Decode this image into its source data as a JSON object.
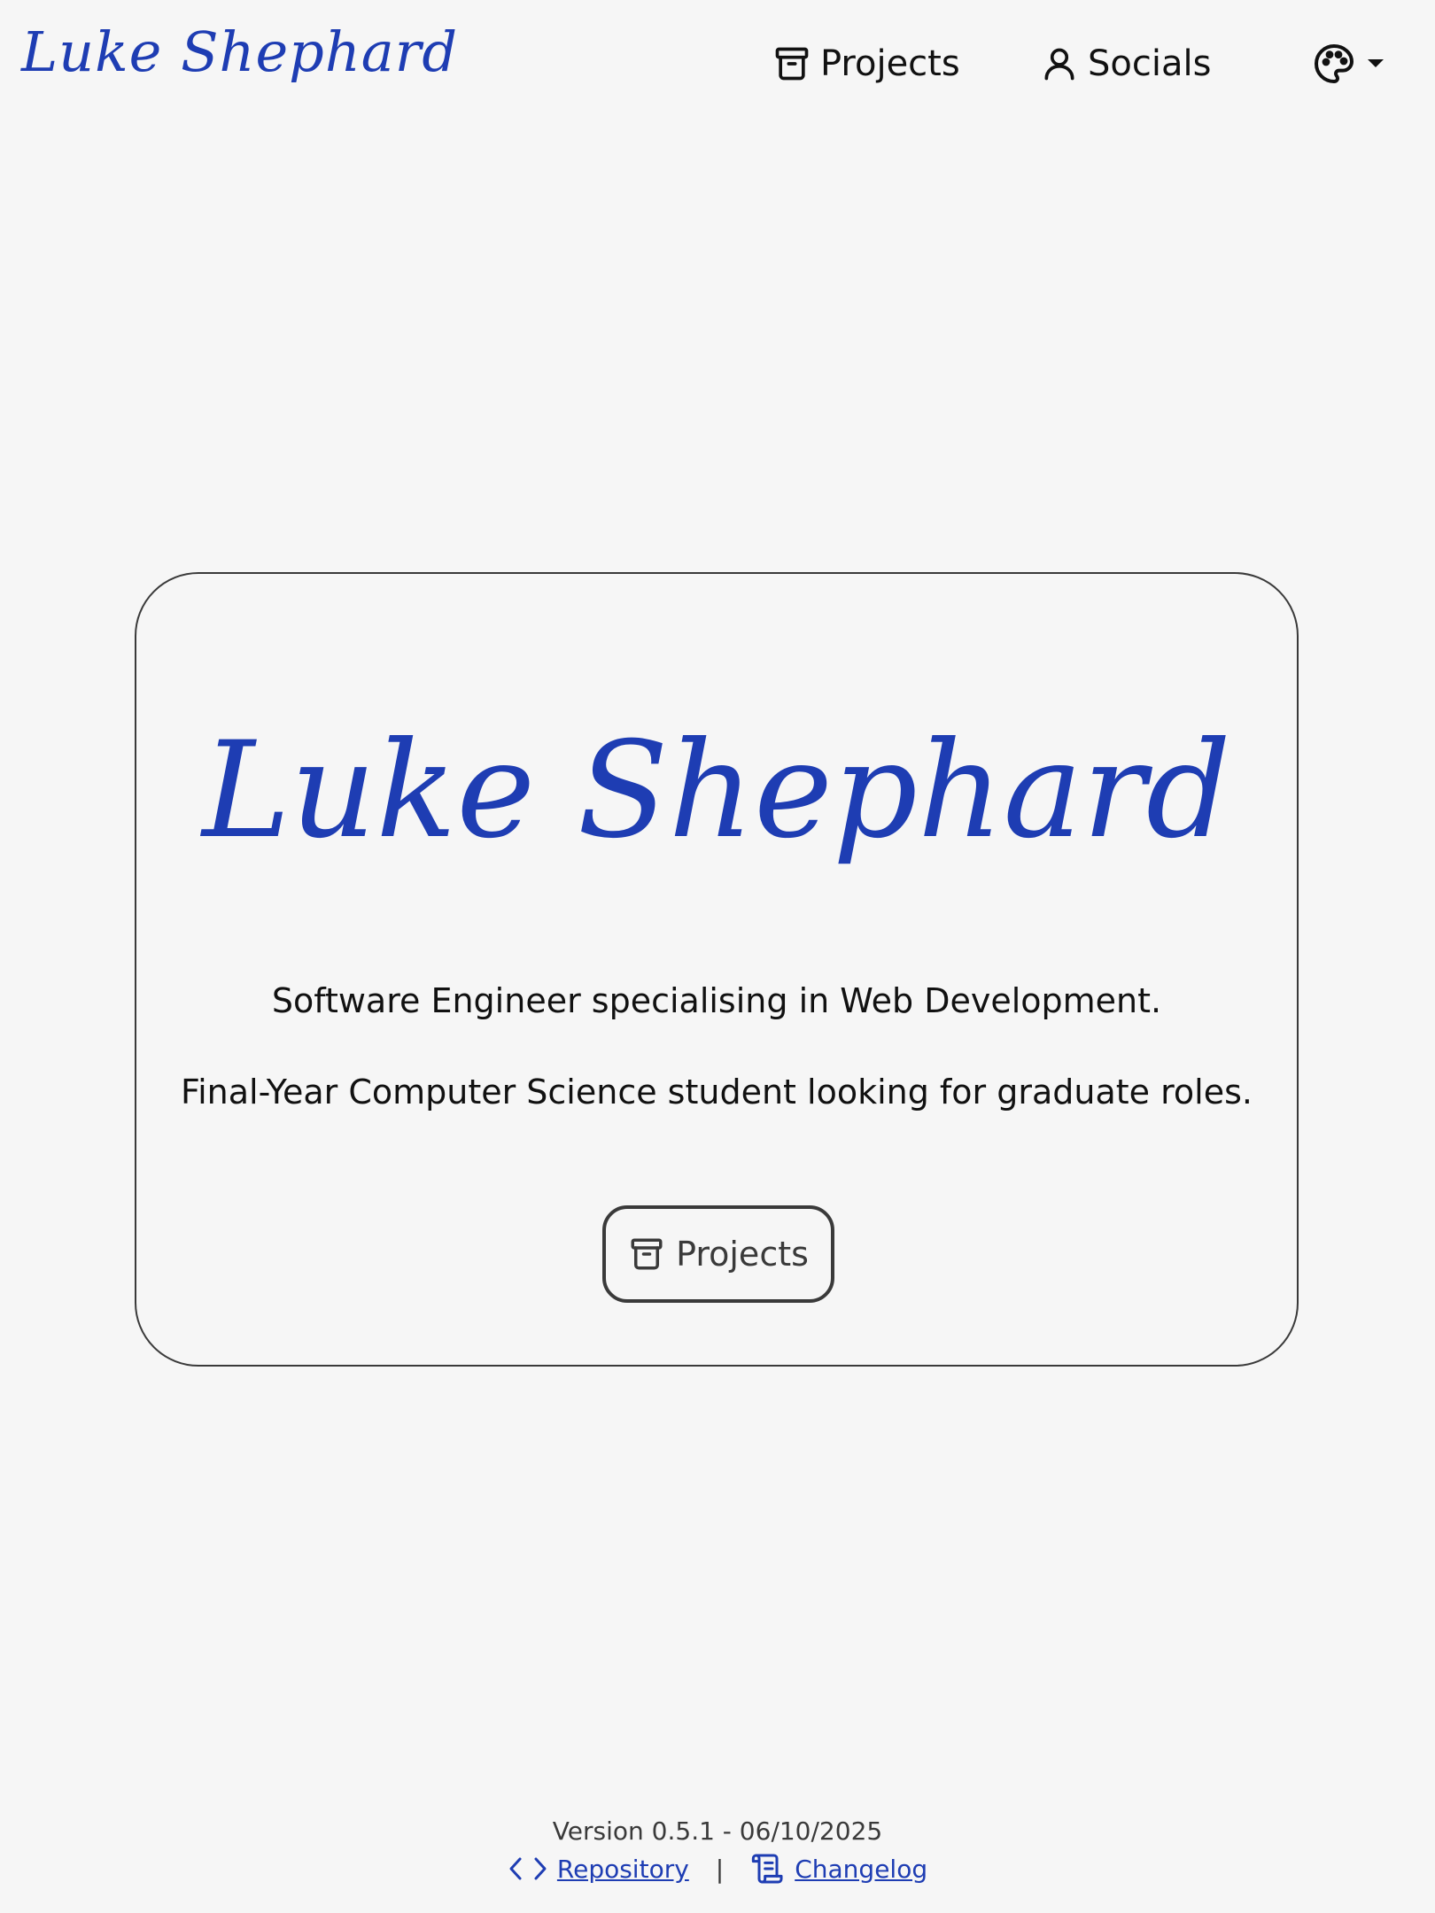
{
  "header": {
    "brand": "Luke Shephard",
    "nav": {
      "projects_label": "Projects",
      "socials_label": "Socials"
    },
    "theme_icon": "palette-icon"
  },
  "hero": {
    "title": "Luke Shephard",
    "tagline_1": "Software Engineer specialising in Web Development.",
    "tagline_2": "Final-Year Computer Science student looking for graduate roles.",
    "button_label": "Projects",
    "button_icon": "archive-icon"
  },
  "footer": {
    "version": "Version 0.5.1 - 06/10/2025",
    "repository_label": "Repository",
    "separator": "|",
    "changelog_label": "Changelog"
  },
  "colors": {
    "background": "#f6f6f6",
    "accent": "#1e3db3",
    "text": "#111111",
    "border": "#3a3a3a"
  }
}
